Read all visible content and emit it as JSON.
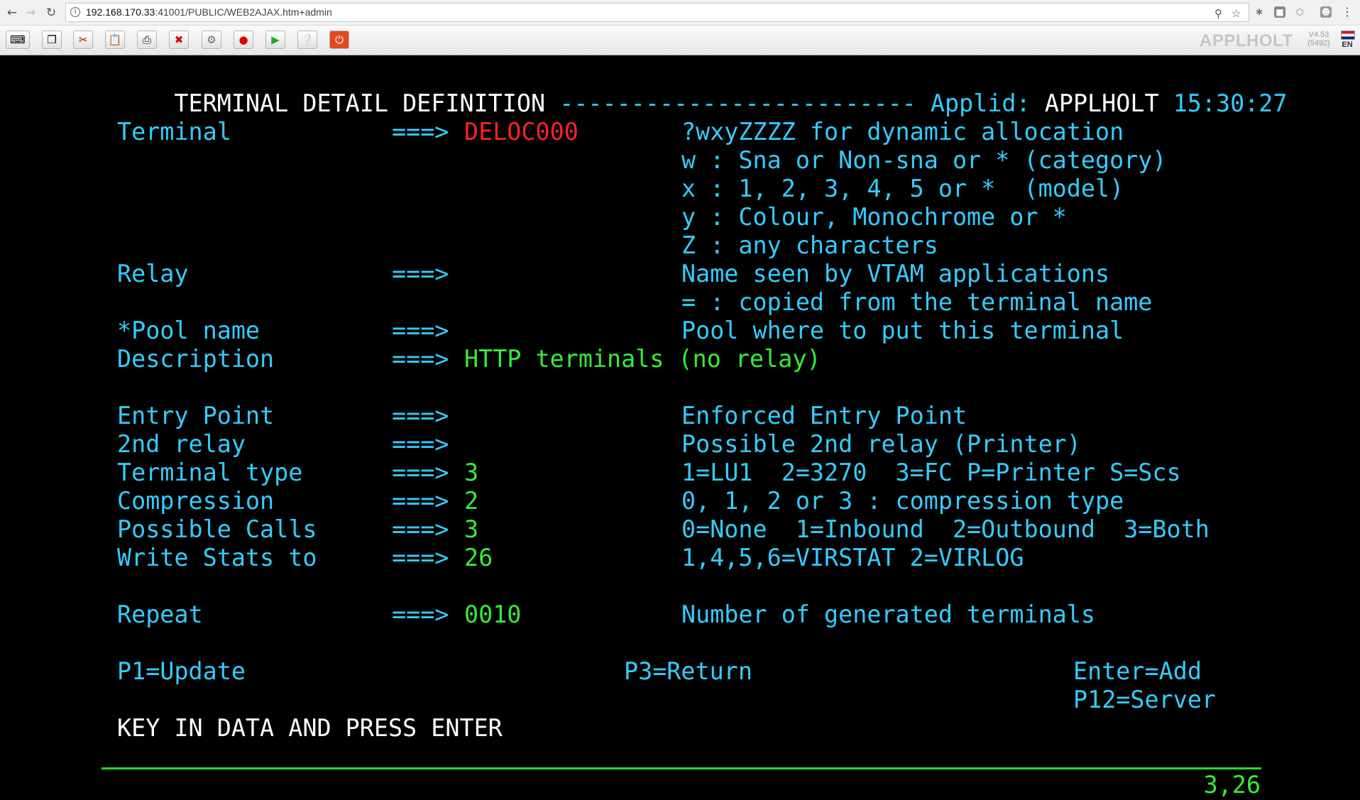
{
  "browser": {
    "url_host": "192.168.170.33",
    "url_rest": ":41001/PUBLIC/WEB2AJAX.htm+admin",
    "back_icon": "arrow-left-icon",
    "forward_icon": "arrow-right-icon",
    "reload_icon": "reload-icon"
  },
  "toolbar": {
    "icons": [
      "keyboard-icon",
      "copy-icon",
      "cut-icon",
      "paste-icon",
      "print-icon",
      "close-session-icon",
      "settings-icon",
      "record-icon",
      "play-icon",
      "help-icon",
      "power-icon"
    ],
    "brand": "APPLHOLT",
    "version": "V4.53",
    "build": "(5492)",
    "lang": "EN"
  },
  "screen": {
    "title": "TERMINAL DETAIL DEFINITION",
    "title_rule": "-------------------------",
    "applid_label": "Applid:",
    "applid_value": "APPLHOLT",
    "time": "15:30:27",
    "arrow": "===>",
    "fields": {
      "terminal": {
        "label": "Terminal",
        "value": "DELOC000"
      },
      "relay": {
        "label": "Relay",
        "value": ""
      },
      "pool": {
        "label": "*Pool name",
        "value": ""
      },
      "description": {
        "label": "Description",
        "value": "HTTP terminals (no relay)"
      },
      "entry": {
        "label": "Entry Point",
        "value": ""
      },
      "relay2": {
        "label": "2nd relay",
        "value": ""
      },
      "ttype": {
        "label": "Terminal type",
        "value": "3"
      },
      "compression": {
        "label": "Compression",
        "value": "2"
      },
      "calls": {
        "label": "Possible Calls",
        "value": "3"
      },
      "stats": {
        "label": "Write Stats to",
        "value": "26"
      },
      "repeat": {
        "label": "Repeat",
        "value": "0010"
      }
    },
    "help": {
      "terminal_1": "?wxyZZZZ for dynamic allocation",
      "terminal_2": "w : Sna or Non-sna or * (category)",
      "terminal_3": "x : 1, 2, 3, 4, 5 or *  (model)",
      "terminal_4": "y : Colour, Monochrome or *",
      "terminal_5": "Z : any characters",
      "relay_1": "Name seen by VTAM applications",
      "relay_2": "= : copied from the terminal name",
      "pool": "Pool where to put this terminal",
      "entry": "Enforced Entry Point",
      "relay2": "Possible 2nd relay (Printer)",
      "ttype": "1=LU1  2=3270  3=FC P=Printer S=Scs",
      "compression": "0, 1, 2 or 3 : compression type",
      "calls": "0=None  1=Inbound  2=Outbound  3=Both",
      "stats": "1,4,5,6=VIRSTAT 2=VIRLOG",
      "repeat": "Number of generated terminals"
    },
    "pfkeys": {
      "p1": "P1=Update",
      "p3": "P3=Return",
      "enter": "Enter=Add",
      "p12": "P12=Server"
    },
    "message": "KEY IN DATA AND PRESS ENTER",
    "cursor": "3,26"
  },
  "colors": {
    "background": "#000000",
    "label": "#33ccff",
    "input": "#33ee33",
    "highlight": "#ff2222",
    "title": "#ffffff"
  }
}
